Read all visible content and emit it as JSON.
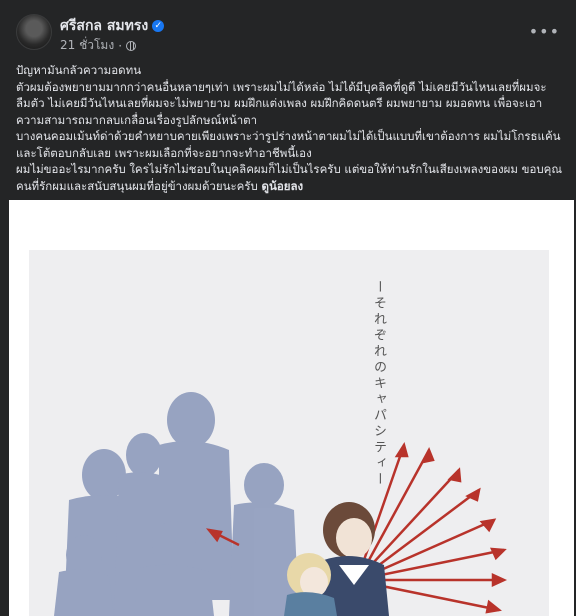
{
  "post": {
    "author": "ศรีสกล สมทรง",
    "time": "21 ชั่วโมง",
    "verified_icon": "verified-badge-icon",
    "privacy_icon": "globe-icon",
    "more_label": "•••",
    "lines": [
      "ปัญหามันกลัวความอดทน",
      "ตัวผมต้องพยายามมากกว่าคนอื่นหลายๆเท่า เพราะผมไม่ได้หล่อ ไม่ได้มีบุคลิคที่ดูดี ไม่เคยมีวันไหนเลยที่ผมจะลืมตัว ไม่เคยมีวันไหนเลยที่ผมจะไม่พยายาม ผมฝึกแต่งเพลง ผมฝึกคิดดนตรี ผมพยายาม ผมอดทน เพื่อจะเอาความสามารถมากลบเกลื่อนเรื่องรูปลักษณ์หน้าตา",
      "บางคนคอมเม้นท์ด่าด้วยคำหยาบคายเพียงเพราะว่ารูปร่างหน้าตาผมไม่ได้เป็นแบบที่เขาต้องการ ผมไม่โกรธแค้นและโต้ตอบกลับเลย เพราะผมเลือกที่จะอยากจะทำอาชีพนี้เอง",
      "ผมไม่ขออะไรมากครับ ใครไม่รักไม่ชอบในบุคลิคผมก็ไม่เป็นไรครับ แต่ขอให้ท่านรักในเสียงเพลงของผม ขอบคุณคนที่รักผมและสนับสนุนผมที่อยู่ข้างผมด้วยนะครับ"
    ],
    "tag": "ดูน้อยลง"
  },
  "image": {
    "vertical_text": "ーそれぞれのキャパシティー",
    "colors": {
      "silhouette": "#8e9bbd",
      "arrow": "#b8332b",
      "hair": "#6b4a3a"
    }
  }
}
